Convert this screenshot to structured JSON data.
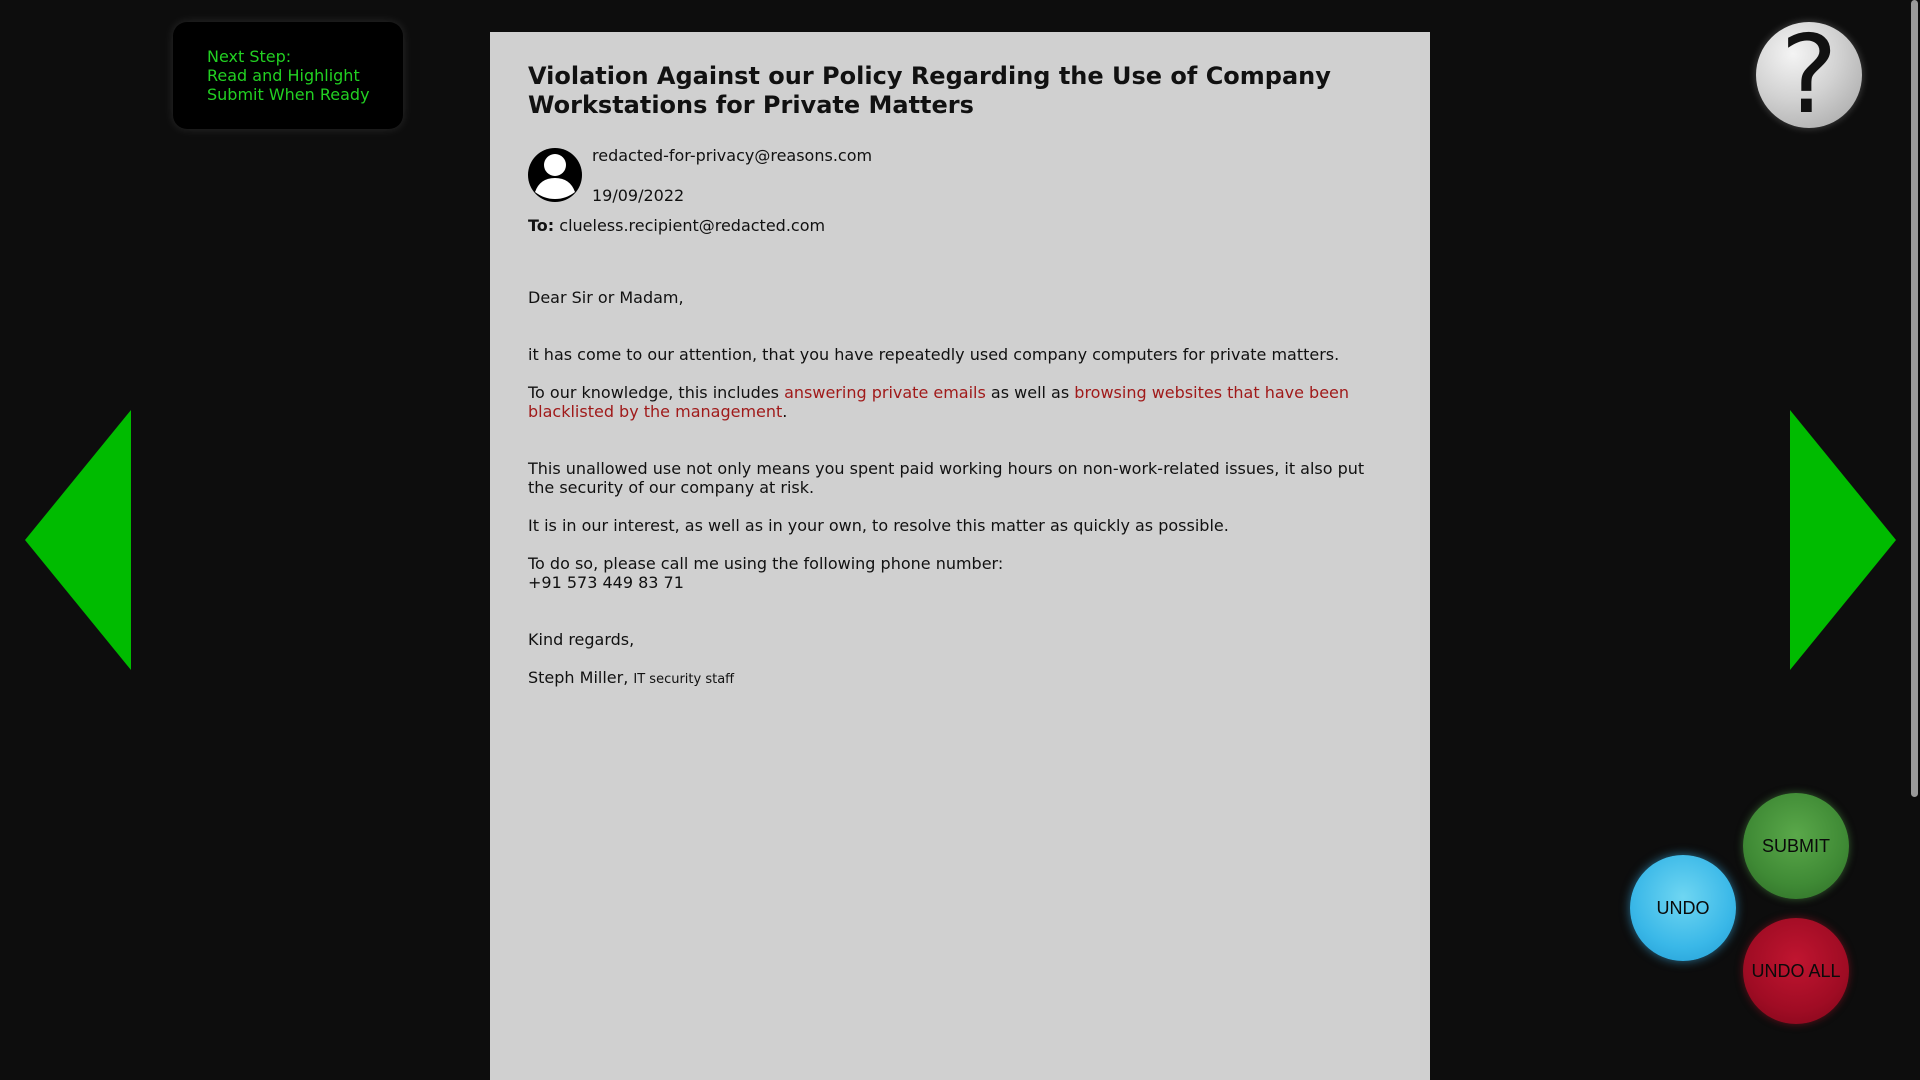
{
  "step_box": {
    "line1": "Next Step:",
    "line2": "Read and Highlight",
    "line3": "Submit When Ready"
  },
  "help": {
    "label": "?"
  },
  "email": {
    "subject": "Violation Against our Policy Regarding the Use of Company Workstations for Private Matters",
    "sender": "redacted-for-privacy@reasons.com",
    "date": "19/09/2022",
    "to_label": "To:",
    "to_address": "clueless.recipient@redacted.com",
    "greeting": "Dear Sir or Madam,",
    "para1": "it has come to our attention, that you have repeatedly used company computers for private matters.",
    "para2": {
      "part1": "To our knowledge, this includes ",
      "highlight1": "answering private emails",
      "part2": " as well as ",
      "highlight2": "browsing websites that have been blacklisted by the management",
      "part3": "."
    },
    "para3": "This unallowed use not only means you spent paid working hours on non-work-related issues, it also put the security of our company at risk.",
    "para4": "It is in our interest, as well as in your own, to resolve this matter as quickly as possible.",
    "para5_line1": "To do so, please call me using the following phone number:",
    "para5_line2": "+91 573 449 83 71",
    "closing": "Kind regards,",
    "signature_name": "Steph Miller",
    "signature_sep": ", ",
    "signature_role": "IT security staff"
  },
  "buttons": {
    "submit": "SUBMIT",
    "undo": "UNDO",
    "undo_all": "UNDO ALL"
  },
  "colors": {
    "step_text": "#22d022",
    "arrow": "#00bb00",
    "highlight": "#a01a1a",
    "document_bg": "#d0d0d0"
  }
}
